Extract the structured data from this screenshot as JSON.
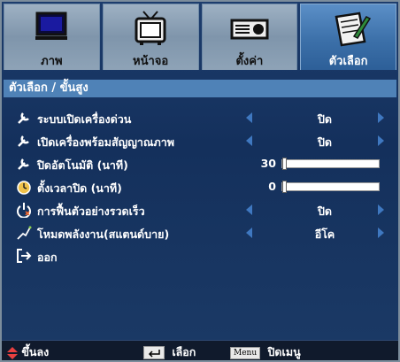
{
  "tabs": [
    {
      "label": "ภาพ",
      "icon": "monitor-icon",
      "active": false
    },
    {
      "label": "หน้าจอ",
      "icon": "tv-icon",
      "active": false
    },
    {
      "label": "ตั้งค่า",
      "icon": "projector-icon",
      "active": false
    },
    {
      "label": "ตัวเลือก",
      "icon": "notepad-icon",
      "active": true
    }
  ],
  "section_title": "ตัวเลือก / ขั้นสูง",
  "rows": [
    {
      "label": "ระบบเปิดเครื่องด่วน",
      "value": "ปิด",
      "icon": "wrench-icon"
    },
    {
      "label": "เปิดเครื่องพร้อมสัญญาณภาพ",
      "value": "ปิด",
      "icon": "wrench-icon"
    },
    {
      "label": "ปิดอัตโนมัติ (นาที)",
      "number": "30",
      "level_fraction": 0.0,
      "icon": "wrench-icon"
    },
    {
      "label": "ตั้งเวลาปิด (นาที)",
      "number": "0",
      "level_fraction": 0.0,
      "icon": "clock-icon"
    },
    {
      "label": "การฟื้นตัวอย่างรวดเร็ว",
      "value": "ปิด",
      "icon": "power-icon"
    },
    {
      "label": "โหมดพลังงาน(สแตนด์บาย)",
      "value": "อีโค",
      "icon": "signal-icon"
    },
    {
      "label": "ออก",
      "icon": "exit-icon"
    }
  ],
  "footer": {
    "nav": "ขึ้นลง",
    "select": "เลือก",
    "menu_key": "Menu",
    "close": "ปิดเมนู"
  },
  "colors": {
    "accent": "#3f78c0",
    "active_tab": "#3c70a9",
    "background": "#14305c"
  }
}
